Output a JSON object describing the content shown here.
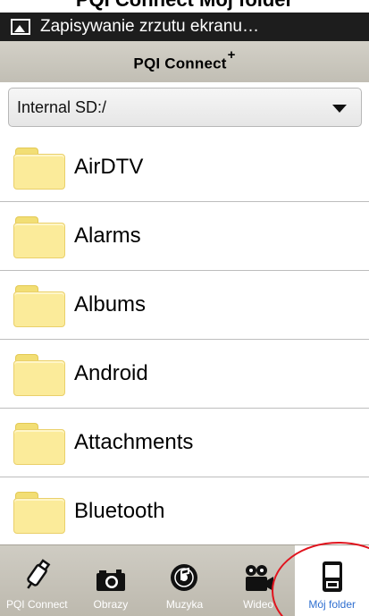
{
  "top_clip": {
    "text": "PQI Connect Mój folder"
  },
  "notification": {
    "icon": "screenshot-image-icon",
    "text": "Zapisywanie zrzutu ekranu…"
  },
  "app_bar": {
    "title": "PQI Connect",
    "title_superscript": "+"
  },
  "path_dropdown": {
    "selected": "Internal SD:/",
    "icon": "chevron-down-icon"
  },
  "files": [
    {
      "name": "AirDTV",
      "icon": "folder-icon"
    },
    {
      "name": "Alarms",
      "icon": "folder-icon"
    },
    {
      "name": "Albums",
      "icon": "folder-icon"
    },
    {
      "name": "Android",
      "icon": "folder-icon"
    },
    {
      "name": "Attachments",
      "icon": "folder-icon"
    },
    {
      "name": "Bluetooth",
      "icon": "folder-icon"
    }
  ],
  "tab_bar": {
    "active_color": "#2f6fd0",
    "tabs": [
      {
        "label": "PQI Connect",
        "icon": "usb-drive-icon",
        "active": false
      },
      {
        "label": "Obrazy",
        "icon": "camera-icon",
        "active": false
      },
      {
        "label": "Muzyka",
        "icon": "music-disc-icon",
        "active": false
      },
      {
        "label": "Wideo",
        "icon": "video-camera-icon",
        "active": false
      },
      {
        "label": "Mój folder",
        "icon": "device-folder-icon",
        "active": true
      }
    ]
  },
  "annotation": {
    "color": "#e0141e"
  }
}
